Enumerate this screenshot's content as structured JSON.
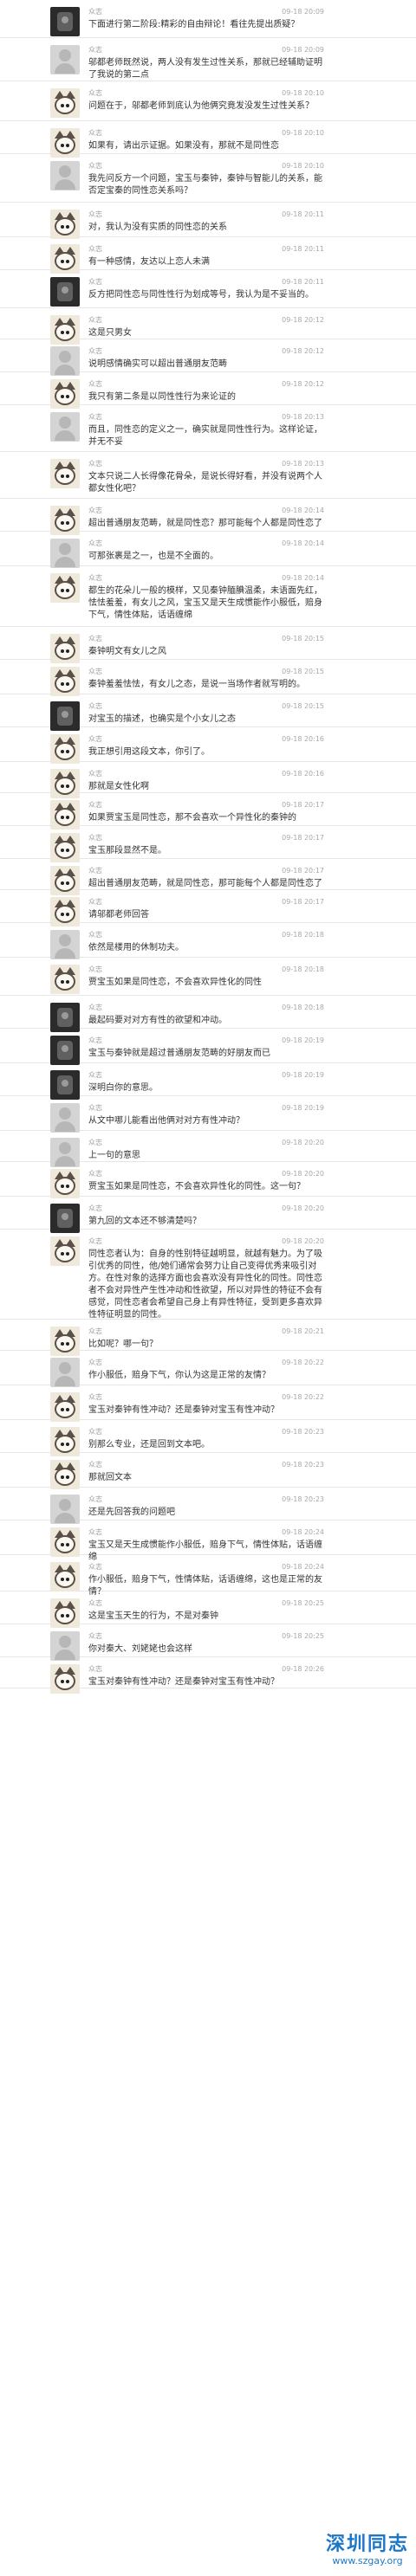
{
  "posts": [
    {
      "author": "众志",
      "time": "09-18 20:09",
      "avatar": "dark",
      "text": "下面进行第二阶段:精彩的自由辩论！看往先提出质疑？",
      "height": 44
    },
    {
      "author": "众志",
      "time": "09-18 20:09",
      "avatar": "plain",
      "text": "邬都老师既然说，两人没有发生过性关系，那就已经辅助证明了我说的第二点",
      "height": 50
    },
    {
      "author": "众志",
      "time": "09-18 20:10",
      "avatar": "cat",
      "text": "问题在于，邬都老师到底认为他俩究竟发没发生过性关系？",
      "height": 46
    },
    {
      "author": "众志",
      "time": "09-18 20:10",
      "avatar": "cat",
      "text": "如果有，请出示证据。如果没有，那就不是同性恋",
      "height": 38
    },
    {
      "author": "众志",
      "time": "09-18 20:10",
      "avatar": "plain",
      "text": "我先问反方一个问题，宝玉与秦钟，秦钟与智能儿的关系，能否定宝秦的同性恋关系吗？",
      "height": 56
    },
    {
      "author": "众志",
      "time": "09-18 20:11",
      "avatar": "cat",
      "text": "对，我认为没有实质的同性恋的关系",
      "height": 40
    },
    {
      "author": "众志",
      "time": "09-18 20:11",
      "avatar": "cat",
      "text": "有一种感情，友达以上恋人未满",
      "height": 38
    },
    {
      "author": "众志",
      "time": "09-18 20:11",
      "avatar": "dark",
      "text": "反方把同性恋与同性性行为划成等号，我认为是不妥当的。",
      "height": 44
    },
    {
      "author": "众志",
      "time": "09-18 20:12",
      "avatar": "cat",
      "text": "这是只男女",
      "height": 36
    },
    {
      "author": "众志",
      "time": "09-18 20:12",
      "avatar": "plain",
      "text": "说明感情确实可以超出普通朋友范畴",
      "height": 38
    },
    {
      "author": "众志",
      "time": "09-18 20:12",
      "avatar": "cat",
      "text": "我只有第二条是以同性性行为来论证的",
      "height": 38
    },
    {
      "author": "众志",
      "time": "09-18 20:13",
      "avatar": "plain",
      "text": "而且，同性恋的定义之一，确实就是同性性行为。这样论证，并无不妥",
      "height": 54
    },
    {
      "author": "众志",
      "time": "09-18 20:13",
      "avatar": "cat",
      "text": "文本只说二人长得像花骨朵，是说长得好看，并没有说两个人都女性化吧？",
      "height": 54
    },
    {
      "author": "众志",
      "time": "09-18 20:14",
      "avatar": "cat",
      "text": "超出普通朋友范畴，就是同性恋？那可能每个人都是同性恋了",
      "height": 38
    },
    {
      "author": "众志",
      "time": "09-18 20:14",
      "avatar": "plain",
      "text": "可那张裹是之一，也是不全面的。",
      "height": 40
    },
    {
      "author": "众志",
      "time": "09-18 20:14",
      "avatar": "cat",
      "text": "都生的花朵儿一般的模样，又见秦钟腼腆温柔，未语面先红，怯怯羞羞，有女儿之风，宝玉又是天生成惯能作小服低，赔身下气，情性体贴，话语缠绵",
      "height": 70
    },
    {
      "author": "众志",
      "time": "09-18 20:15",
      "avatar": "cat",
      "text": "秦钟明文有女儿之风",
      "height": 38
    },
    {
      "author": "众志",
      "time": "09-18 20:15",
      "avatar": "cat",
      "text": "秦钟羞羞怯怯，有女儿之态，是说一当场作者就写明的。",
      "height": 40
    },
    {
      "author": "众志",
      "time": "09-18 20:15",
      "avatar": "dark",
      "text": "对宝玉的描述，也确实是个小女儿之态",
      "height": 38
    },
    {
      "author": "众志",
      "time": "09-18 20:16",
      "avatar": "cat",
      "text": "我正想引用这段文本，你引了。",
      "height": 40
    },
    {
      "author": "众志",
      "time": "09-18 20:16",
      "avatar": "cat",
      "text": "那就是女性化啊",
      "height": 36
    },
    {
      "author": "众志",
      "time": "09-18 20:17",
      "avatar": "cat",
      "text": "如果贾宝玉是同性恋，那不会喜欢一个异性化的秦钟的",
      "height": 38
    },
    {
      "author": "众志",
      "time": "09-18 20:17",
      "avatar": "cat",
      "text": "宝玉那段显然不是。",
      "height": 38
    },
    {
      "author": "众志",
      "time": "09-18 20:17",
      "avatar": "cat",
      "text": "超出普通朋友范畴，就是同性恋，那可能每个人都是同性恋了",
      "height": 36
    },
    {
      "author": "众志",
      "time": "09-18 20:17",
      "avatar": "cat",
      "text": "请邬都老师回答",
      "height": 38
    },
    {
      "author": "众志",
      "time": "09-18 20:18",
      "avatar": "plain",
      "text": "依然是楼用的休制功夫。",
      "height": 40
    },
    {
      "author": "众志",
      "time": "09-18 20:18",
      "avatar": "cat",
      "text": "贾宝玉如果是同性恋，不会喜欢异性化的同性",
      "height": 44
    },
    {
      "author": "众志",
      "time": "09-18 20:18",
      "avatar": "dark",
      "text": "最起码要对对方有性的欲望和冲动。",
      "height": 38
    },
    {
      "author": "众志",
      "time": "09-18 20:19",
      "avatar": "dark",
      "text": "宝玉与秦钟就是超过普通朋友范畴的好朋友而已",
      "height": 40
    },
    {
      "author": "众志",
      "time": "09-18 20:19",
      "avatar": "dark",
      "text": "深明白你的意思。",
      "height": 38
    },
    {
      "author": "众志",
      "time": "09-18 20:19",
      "avatar": "plain",
      "text": "从文中哪儿能看出他俩对对方有性冲动？",
      "height": 40
    },
    {
      "author": "众志",
      "time": "09-18 20:20",
      "avatar": "plain",
      "text": "上一句的意思",
      "height": 36
    },
    {
      "author": "众志",
      "time": "09-18 20:20",
      "avatar": "cat",
      "text": "贾宝玉如果是同性恋，不会喜欢异性化的同性。这一句？",
      "height": 40
    },
    {
      "author": "众志",
      "time": "09-18 20:20",
      "avatar": "dark",
      "text": "第九回的文本还不够清楚吗？",
      "height": 38
    },
    {
      "author": "众志",
      "time": "09-18 20:20",
      "avatar": "cat",
      "text": "同性恋者认为：自身的性别特征越明显，就越有魅力。为了吸引优秀的同性，他/她们通常会努力让自己变得优秀来吸引对方。在性对象的选择方面也会喜欢没有异性化的同性。同性恋者不会对异性产生性冲动和性欲望，所以对异性的特征不会有感觉，同性恋者会希望自己身上有异性特征，受到更多喜欢异性特征明显的同性。",
      "height": 104
    },
    {
      "author": "众志",
      "time": "09-18 20:21",
      "avatar": "cat",
      "text": "比如呢？哪一句？",
      "height": 36
    },
    {
      "author": "众志",
      "time": "09-18 20:22",
      "avatar": "plain",
      "text": "作小服低，赔身下气，你认为这是正常的友情？",
      "height": 40
    },
    {
      "author": "众志",
      "time": "09-18 20:22",
      "avatar": "cat",
      "text": "宝玉对秦钟有性冲动？还是秦钟对宝玉有性冲动？",
      "height": 40
    },
    {
      "author": "众志",
      "time": "09-18 20:23",
      "avatar": "cat",
      "text": "别那么专业，还是回到文本吧。",
      "height": 38
    },
    {
      "author": "众志",
      "time": "09-18 20:23",
      "avatar": "cat",
      "text": "那就回文本",
      "height": 40
    },
    {
      "author": "众志",
      "time": "09-18 20:23",
      "avatar": "plain",
      "text": "还是先回答我的问题吧",
      "height": 38
    },
    {
      "author": "众志",
      "time": "09-18 20:24",
      "avatar": "cat",
      "text": "宝玉又是天生成惯能作小服低，赔身下气，情性体贴，话语缠绵",
      "height": 40
    },
    {
      "author": "众志",
      "time": "09-18 20:24",
      "avatar": "cat",
      "text": "作小服低，赔身下气，性情体贴，话语缠绵，这也是正常的友情？",
      "height": 42
    },
    {
      "author": "众志",
      "time": "09-18 20:25",
      "avatar": "cat",
      "text": "这是宝玉天生的行为，不是对秦钟",
      "height": 38
    },
    {
      "author": "众志",
      "time": "09-18 20:25",
      "avatar": "plain",
      "text": "你对秦大、刘姥姥也会这样",
      "height": 38
    },
    {
      "author": "众志",
      "time": "09-18 20:26",
      "avatar": "cat",
      "text": "宝玉对秦钟有性冲动？还是秦钟对宝玉有性冲动？",
      "height": 36
    }
  ],
  "watermark": {
    "title": "深圳同志",
    "url": "www.szgay.org"
  }
}
